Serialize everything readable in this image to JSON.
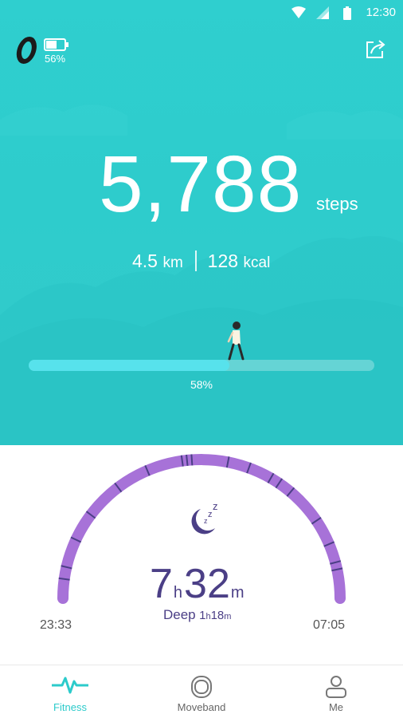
{
  "status_bar": {
    "time": "12:30"
  },
  "device": {
    "battery_percent": "56%"
  },
  "steps": {
    "value": "5,788",
    "unit": "steps"
  },
  "distance": {
    "value": "4.5",
    "unit": "km"
  },
  "calories": {
    "value": "128",
    "unit": "kcal"
  },
  "goal_progress": {
    "label": "58%",
    "fraction": 0.58
  },
  "sleep": {
    "hours": "7",
    "hours_unit": "h",
    "minutes": "32",
    "minutes_unit": "m",
    "deep_label": "Deep",
    "deep_hours": "1",
    "deep_hours_unit": "h",
    "deep_minutes": "18",
    "deep_minutes_unit": "m",
    "start_time": "23:33",
    "end_time": "07:05"
  },
  "nav": {
    "items": [
      {
        "label": "Fitness",
        "icon": "pulse-icon",
        "active": true
      },
      {
        "label": "Moveband",
        "icon": "band-icon",
        "active": false
      },
      {
        "label": "Me",
        "icon": "person-icon",
        "active": false
      }
    ]
  },
  "colors": {
    "hero": "#2ecccc",
    "progress_fill": "#57e2ec",
    "sleep_arc": "#a772d8",
    "sleep_tick": "#4b3f86",
    "text_dark": "#4b3f86",
    "accent": "#2ccbcb"
  }
}
